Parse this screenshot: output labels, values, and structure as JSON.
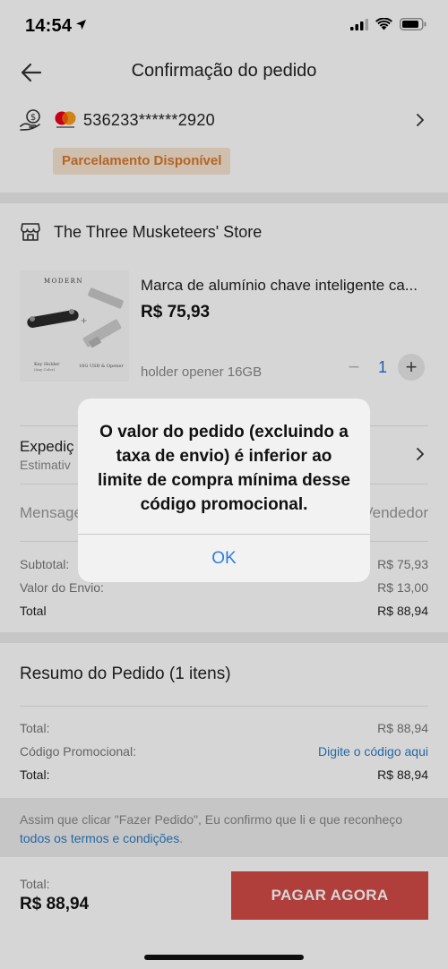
{
  "status_bar": {
    "time": "14:54"
  },
  "header": {
    "title": "Confirmação do pedido"
  },
  "payment": {
    "card_number": "536233******2920",
    "installment_badge": "Parcelamento Disponível"
  },
  "store": {
    "name": "The Three Musketeers' Store"
  },
  "product": {
    "title": "Marca de alumínio chave inteligente ca...",
    "price": "R$ 75,93",
    "variant": "holder opener 16GB",
    "quantity": "1",
    "image_text": {
      "brand": "MODERN",
      "left_caption": "Key Holder",
      "left_sub": "(Any Color)",
      "right_caption": "16G USB & Opener"
    }
  },
  "shipping": {
    "label": "Expediç",
    "sub": "Estimativ"
  },
  "message": {
    "label": "Mensage",
    "right": "o Vendedor"
  },
  "totals": {
    "subtotal_label": "Subtotal:",
    "subtotal_value": "R$ 75,93",
    "shipping_label": "Valor do Envio:",
    "shipping_value": "R$ 13,00",
    "total_label": "Total",
    "total_value": "R$ 88,94"
  },
  "summary": {
    "title": "Resumo do Pedido (1 itens)",
    "total_label": "Total:",
    "total_value": "R$ 88,94",
    "promo_label": "Código Promocional:",
    "promo_link": "Digite o código aqui",
    "total2_label": "Total:",
    "total2_value": "R$ 88,94"
  },
  "terms": {
    "text": "Assim que clicar \"Fazer Pedido\", Eu confirmo que li e que reconheço ",
    "link": "todos os termos e condições",
    "end": "."
  },
  "footer": {
    "total_label": "Total:",
    "total_value": "R$ 88,94",
    "pay_button": "PAGAR AGORA"
  },
  "alert": {
    "message": "O valor do pedido (excluindo a taxa de envio) é inferior ao limite de compra mínima desse código promocional.",
    "ok": "OK"
  },
  "colors": {
    "accent_red": "#d24b47",
    "link_blue": "#2d7bc4",
    "badge_bg": "#f6e4d0",
    "badge_text": "#d9782c"
  }
}
